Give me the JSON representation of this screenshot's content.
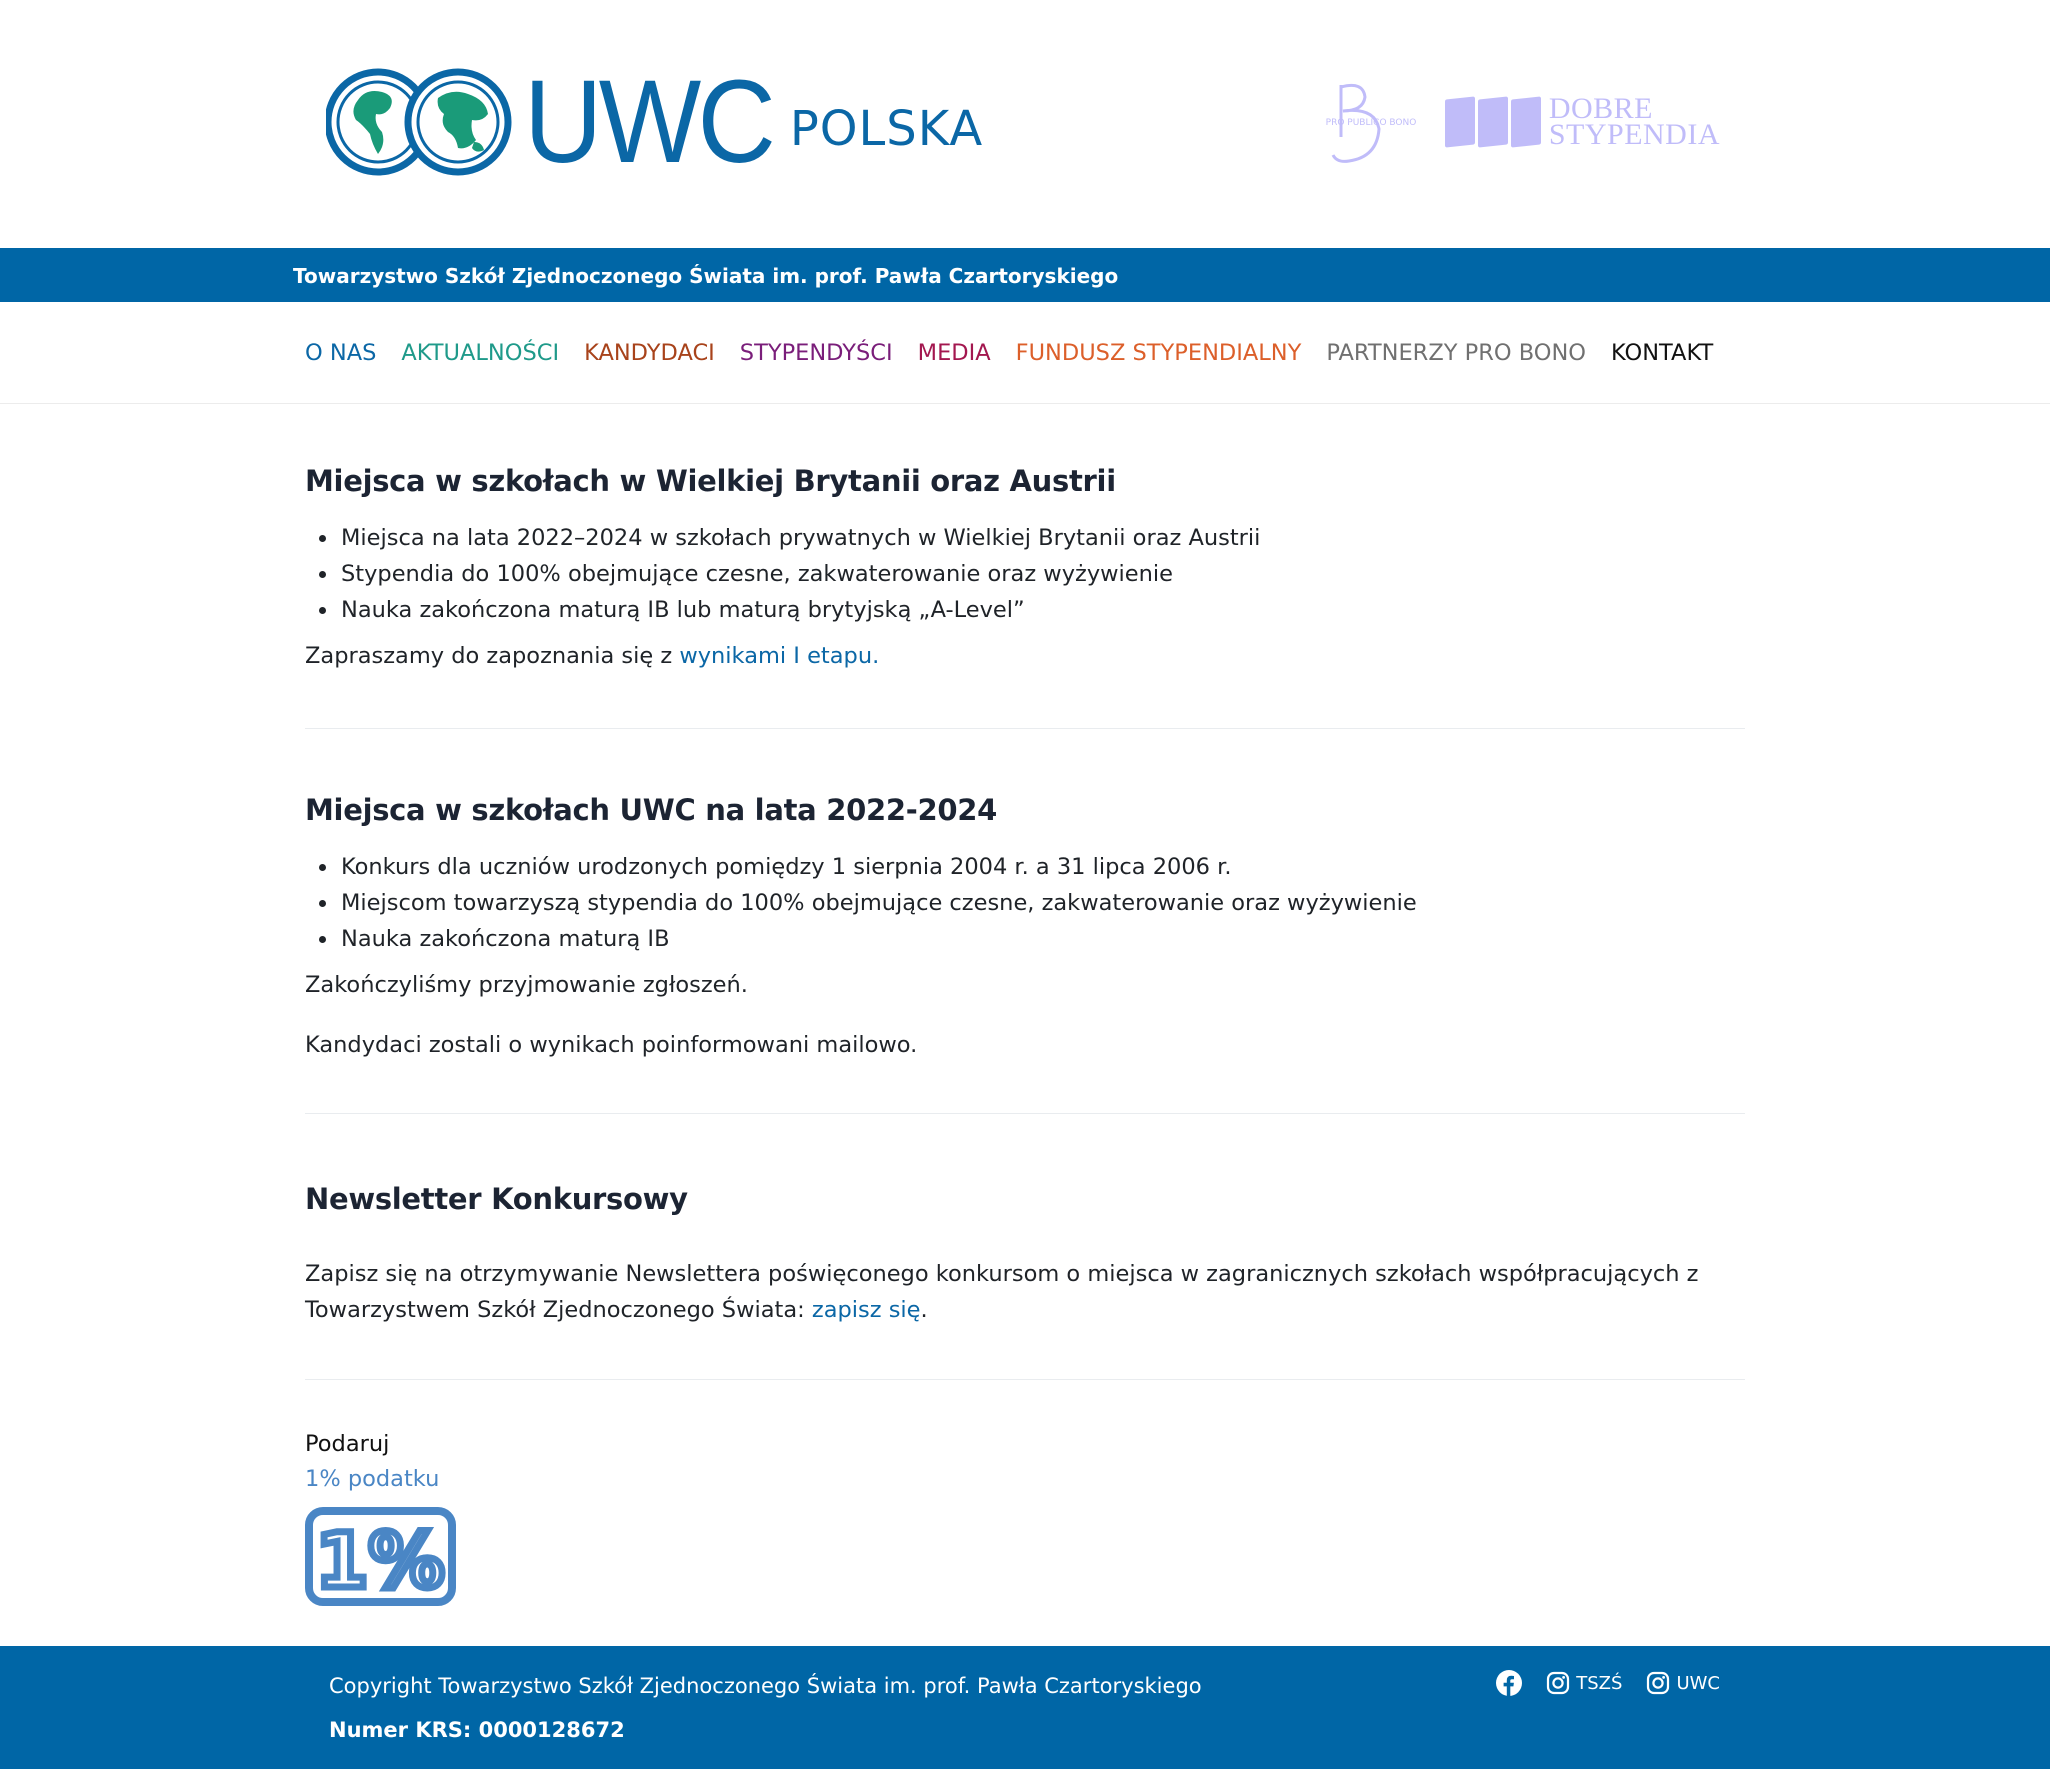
{
  "header": {
    "logo_word": "UWC",
    "logo_sub": "POLSKA",
    "partner_logo_1": "PRO PUBLICO BONO",
    "partner_logo_2_line1": "DOBRE",
    "partner_logo_2_line2": "STYPENDIA"
  },
  "top_strip": {
    "text": "Towarzystwo Szkół Zjednoczonego Świata im. prof. Pawła Czartoryskiego"
  },
  "nav": {
    "items": [
      {
        "label": "O NAS",
        "color": "#0b67a6"
      },
      {
        "label": "AKTUALNOŚCI",
        "color": "#1f9a8a"
      },
      {
        "label": "KANDYDACI",
        "color": "#a8431b"
      },
      {
        "label": "STYPENDYŚCI",
        "color": "#7a1e7a"
      },
      {
        "label": "MEDIA",
        "color": "#a3174f"
      },
      {
        "label": "FUNDUSZ STYPENDIALNY",
        "color": "#dc5f2a"
      },
      {
        "label": "PARTNERZY PRO BONO",
        "color": "#707070"
      },
      {
        "label": "KONTAKT",
        "color": "#111111"
      }
    ]
  },
  "sections": {
    "uk_austria": {
      "title": "Miejsca w szkołach w Wielkiej Brytanii oraz Austrii",
      "bullets": [
        "Miejsca na lata 2022–2024 w szkołach prywatnych w Wielkiej Brytanii oraz Austrii",
        "Stypendia do 100% obejmujące czesne, zakwaterowanie oraz wyżywienie",
        "Nauka zakończona maturą IB lub maturą brytyjską „A-Level”"
      ],
      "invite_text": "Zapraszamy do zapoznania się z ",
      "invite_link": "wynikami I etapu."
    },
    "uwc": {
      "title": "Miejsca w szkołach UWC na lata 2022-2024",
      "bullets": [
        "Konkurs dla uczniów urodzonych pomiędzy 1 sierpnia 2004 r. a 31 lipca 2006 r.",
        "Miejscom towarzyszą stypendia do 100% obejmujące czesne, zakwaterowanie oraz wyżywienie",
        "Nauka zakończona maturą IB"
      ],
      "closed_text": "Zakończyliśmy przyjmowanie zgłoszeń.",
      "informed_text": "Kandydaci zostali o wynikach poinformowani mailowo."
    },
    "newsletter": {
      "title": "Newsletter Konkursowy",
      "text": "Zapisz się na otrzymywanie Newslettera poświęconego konkursom o miejsca w zagranicznych szkołach współpracujących z Towarzystwem Szkół Zjednoczonego Świata: ",
      "link": "zapisz się",
      "after": "."
    }
  },
  "donate": {
    "label": "Podaruj",
    "link": "1% podatku",
    "badge_text": "1%"
  },
  "footer": {
    "copyright": "Copyright Towarzystwo Szkół Zjednoczonego Świata im. prof. Pawła Czartoryskiego",
    "krs": "Numer KRS: 0000128672",
    "socials": [
      {
        "icon": "facebook-icon",
        "label": ""
      },
      {
        "icon": "instagram-icon",
        "label": "TSZŚ"
      },
      {
        "icon": "instagram-icon",
        "label": "UWC"
      }
    ]
  },
  "colors": {
    "brand_blue": "#0066a6",
    "link_blue": "#0b67a6",
    "donate_blue": "#4a86c5",
    "globe_green": "#1a9b79"
  }
}
